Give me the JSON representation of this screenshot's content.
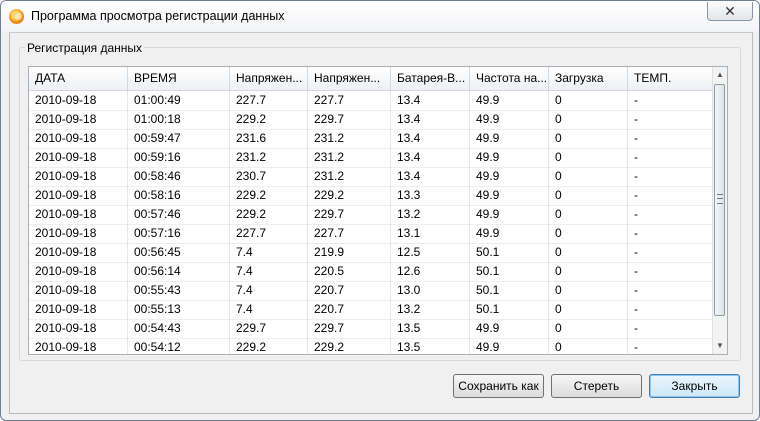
{
  "window": {
    "title": "Программа просмотра регистрации данных"
  },
  "group": {
    "title": "Регистрация данных"
  },
  "table": {
    "columns": [
      "ДАТА",
      "ВРЕМЯ",
      "Напряжен...",
      "Напряжен...",
      "Батарея-В...",
      "Частота на...",
      "Загрузка",
      "ТЕМП."
    ],
    "rows": [
      [
        "2010-09-18",
        "01:00:49",
        "227.7",
        "227.7",
        "13.4",
        "49.9",
        "0",
        "-"
      ],
      [
        "2010-09-18",
        "01:00:18",
        "229.2",
        "229.7",
        "13.4",
        "49.9",
        "0",
        "-"
      ],
      [
        "2010-09-18",
        "00:59:47",
        "231.6",
        "231.2",
        "13.4",
        "49.9",
        "0",
        "-"
      ],
      [
        "2010-09-18",
        "00:59:16",
        "231.2",
        "231.2",
        "13.4",
        "49.9",
        "0",
        "-"
      ],
      [
        "2010-09-18",
        "00:58:46",
        "230.7",
        "231.2",
        "13.4",
        "49.9",
        "0",
        "-"
      ],
      [
        "2010-09-18",
        "00:58:16",
        "229.2",
        "229.2",
        "13.3",
        "49.9",
        "0",
        "-"
      ],
      [
        "2010-09-18",
        "00:57:46",
        "229.2",
        "229.7",
        "13.2",
        "49.9",
        "0",
        "-"
      ],
      [
        "2010-09-18",
        "00:57:16",
        "227.7",
        "227.7",
        "13.1",
        "49.9",
        "0",
        "-"
      ],
      [
        "2010-09-18",
        "00:56:45",
        "7.4",
        "219.9",
        "12.5",
        "50.1",
        "0",
        "-"
      ],
      [
        "2010-09-18",
        "00:56:14",
        "7.4",
        "220.5",
        "12.6",
        "50.1",
        "0",
        "-"
      ],
      [
        "2010-09-18",
        "00:55:43",
        "7.4",
        "220.7",
        "13.0",
        "50.1",
        "0",
        "-"
      ],
      [
        "2010-09-18",
        "00:55:13",
        "7.4",
        "220.7",
        "13.2",
        "50.1",
        "0",
        "-"
      ],
      [
        "2010-09-18",
        "00:54:43",
        "229.7",
        "229.7",
        "13.5",
        "49.9",
        "0",
        "-"
      ],
      [
        "2010-09-18",
        "00:54:12",
        "229.2",
        "229.2",
        "13.5",
        "49.9",
        "0",
        "-"
      ]
    ]
  },
  "buttons": {
    "save_as": "Сохранить как",
    "erase": "Стереть",
    "close": "Закрыть"
  },
  "icons": {
    "app": "app-icon",
    "close": "close-icon"
  }
}
